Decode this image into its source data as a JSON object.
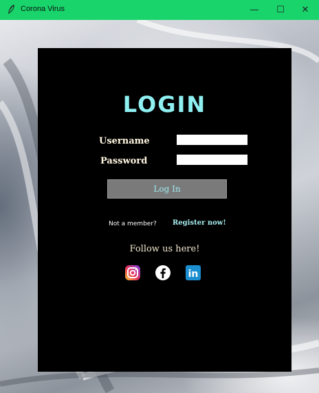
{
  "window": {
    "title": "Corona Virus",
    "controls": {
      "minimize": "—",
      "maximize": "☐",
      "close": "✕"
    },
    "titlebar_color": "#18d46b"
  },
  "login": {
    "heading": "LOGIN",
    "username_label": "Username",
    "password_label": "Password",
    "username_value": "",
    "password_value": "",
    "login_button": "Log In",
    "not_member": "Not a member?",
    "register_link": "Register now!",
    "follow_text": "Follow us here!"
  },
  "social": {
    "instagram": "instagram-icon",
    "facebook": "facebook-icon",
    "linkedin": "linkedin-icon",
    "linkedin_text": "in"
  },
  "colors": {
    "accent": "#8ff0f2",
    "panel": "#000000",
    "button": "#7a7a7a"
  }
}
